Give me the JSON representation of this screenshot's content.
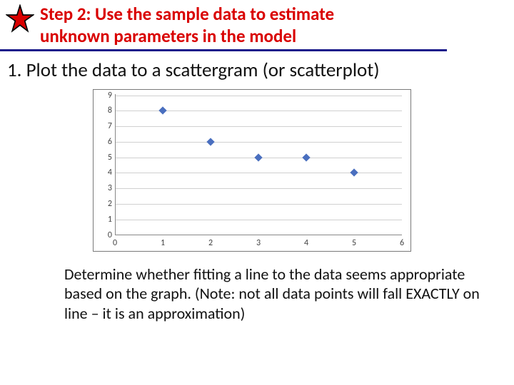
{
  "header": {
    "title_line1": "Step 2:  Use the sample data to estimate",
    "title_line2": "unknown parameters in the model"
  },
  "item1": "1. Plot the data to a scattergram (or scatterplot)",
  "caption": "Determine whether fitting a line to the data seems appropriate based on the graph.  (Note:  not all data points will fall EXACTLY on line – it is an approximation)",
  "chart_data": {
    "type": "scatter",
    "title": "",
    "xlabel": "",
    "ylabel": "",
    "xlim": [
      0,
      6
    ],
    "ylim": [
      0,
      9
    ],
    "xticks": [
      0,
      1,
      2,
      3,
      4,
      5,
      6
    ],
    "yticks": [
      0,
      1,
      2,
      3,
      4,
      5,
      6,
      7,
      8,
      9
    ],
    "grid": "horizontal",
    "series": [
      {
        "name": "data",
        "color": "#4a6fbf",
        "marker": "diamond",
        "points": [
          {
            "x": 1,
            "y": 8
          },
          {
            "x": 2,
            "y": 6
          },
          {
            "x": 3,
            "y": 5
          },
          {
            "x": 4,
            "y": 5
          },
          {
            "x": 5,
            "y": 4
          }
        ]
      }
    ]
  }
}
